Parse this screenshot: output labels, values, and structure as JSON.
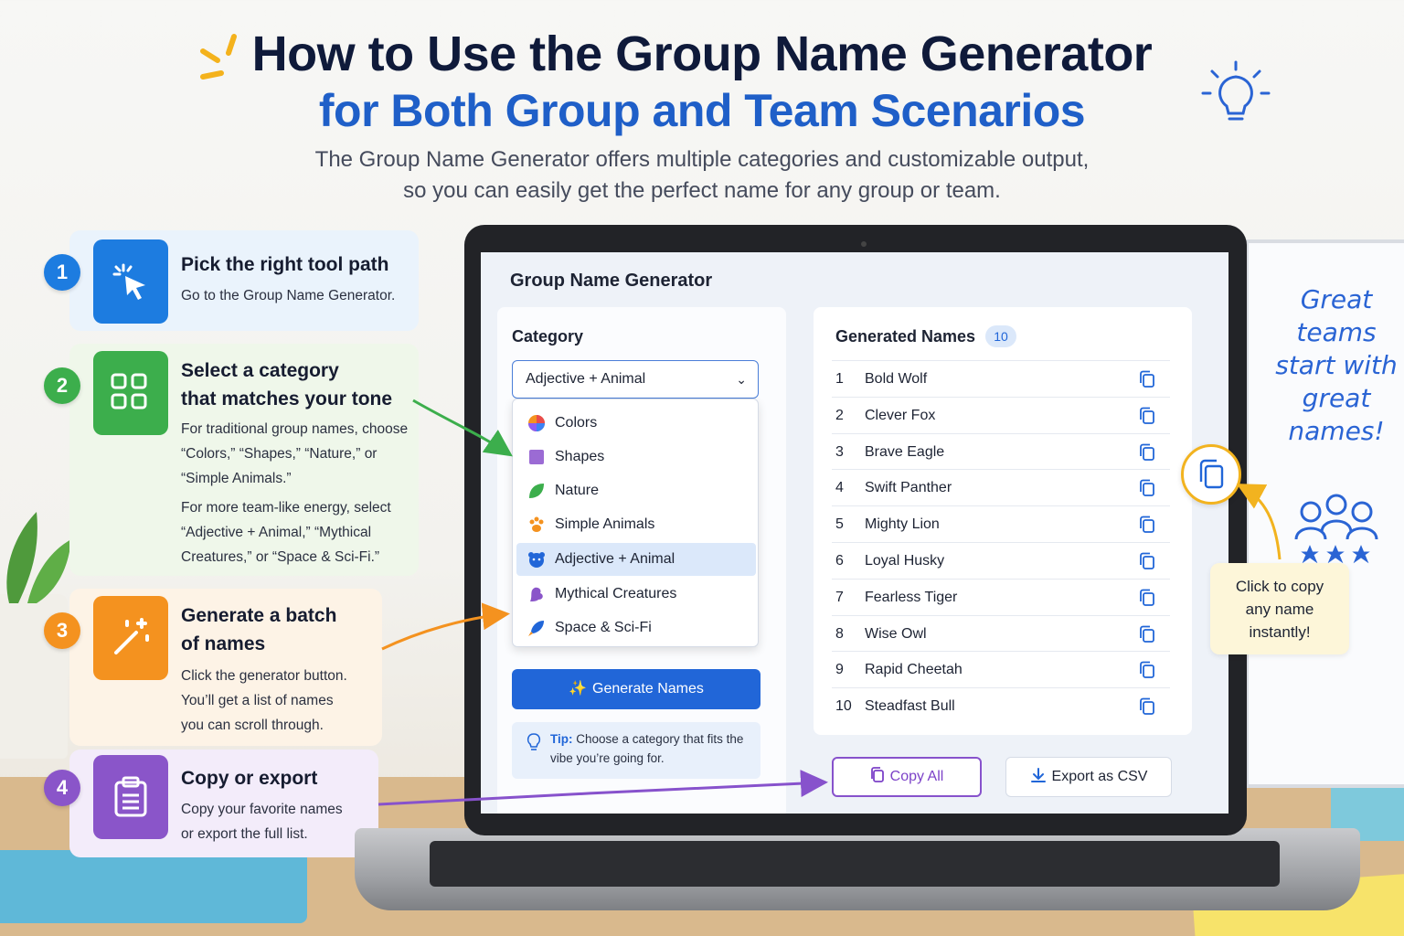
{
  "header": {
    "title_line1": "How to Use the Group Name Generator",
    "title_line2": "for Both Group and Team Scenarios",
    "subtitle_line1": "The Group Name Generator offers multiple categories and customizable output,",
    "subtitle_line2": "so you can easily get the perfect name for any group or team."
  },
  "steps": [
    {
      "number": "1",
      "title": "Pick the right tool path",
      "desc": [
        "Go to the Group Name Generator."
      ],
      "icon": "cursor-click-icon",
      "color": "#1d7ce0"
    },
    {
      "number": "2",
      "title_line1": "Select a category",
      "title_line2": "that matches your tone",
      "desc": [
        "For traditional group names, choose",
        "“Colors,” “Shapes,” “Nature,” or",
        "“Simple Animals.”",
        "For more team-like energy, select",
        "“Adjective + Animal,” “Mythical",
        "Creatures,” or “Space & Sci-Fi.”"
      ],
      "icon": "grid-icon",
      "color": "#3cae4c"
    },
    {
      "number": "3",
      "title_line1": "Generate a batch",
      "title_line2": "of names",
      "desc": [
        "Click the generator button.",
        "You’ll get a list of names",
        "you can scroll through."
      ],
      "icon": "magic-wand-icon",
      "color": "#f4921f"
    },
    {
      "number": "4",
      "title": "Copy or export",
      "desc": [
        "Copy your favorite names",
        "or export the full list."
      ],
      "icon": "clipboard-icon",
      "color": "#8a55c9"
    }
  ],
  "app": {
    "title": "Group Name Generator",
    "category_label": "Category",
    "selected_category": "Adjective + Animal",
    "dropdown_options": [
      {
        "label": "Colors",
        "icon": "color-wheel-icon"
      },
      {
        "label": "Shapes",
        "icon": "square-icon"
      },
      {
        "label": "Nature",
        "icon": "leaf-icon"
      },
      {
        "label": "Simple Animals",
        "icon": "paw-icon"
      },
      {
        "label": "Adjective + Animal",
        "icon": "bear-icon",
        "active": true
      },
      {
        "label": "Mythical Creatures",
        "icon": "dragon-icon"
      },
      {
        "label": "Space & Sci-Fi",
        "icon": "rocket-icon"
      }
    ],
    "generate_button": "Generate Names",
    "tip_label": "Tip:",
    "tip_text_line1": " Choose a category that fits the",
    "tip_text_line2": "vibe you’re going for.",
    "generated_title": "Generated Names",
    "generated_count": "10",
    "names": [
      {
        "num": "1",
        "name": "Bold Wolf"
      },
      {
        "num": "2",
        "name": "Clever Fox"
      },
      {
        "num": "3",
        "name": "Brave Eagle"
      },
      {
        "num": "4",
        "name": "Swift Panther"
      },
      {
        "num": "5",
        "name": "Mighty Lion"
      },
      {
        "num": "6",
        "name": "Loyal Husky"
      },
      {
        "num": "7",
        "name": "Fearless Tiger"
      },
      {
        "num": "8",
        "name": "Wise Owl"
      },
      {
        "num": "9",
        "name": "Rapid Cheetah"
      },
      {
        "num": "10",
        "name": "Steadfast Bull"
      }
    ],
    "copy_all_button": "Copy All",
    "export_button": "Export as CSV"
  },
  "whiteboard": {
    "lines": [
      "Great",
      "teams",
      "start with",
      "great",
      "names!"
    ]
  },
  "callout": {
    "lines": [
      "Click to copy",
      "any name",
      "instantly!"
    ]
  },
  "colors": {
    "title_dark": "#0f1a3a",
    "title_blue": "#1f5fc8",
    "primary_button": "#2166d8",
    "copy_all_purple": "#8752cc",
    "callout_yellow": "#f2b31f"
  }
}
